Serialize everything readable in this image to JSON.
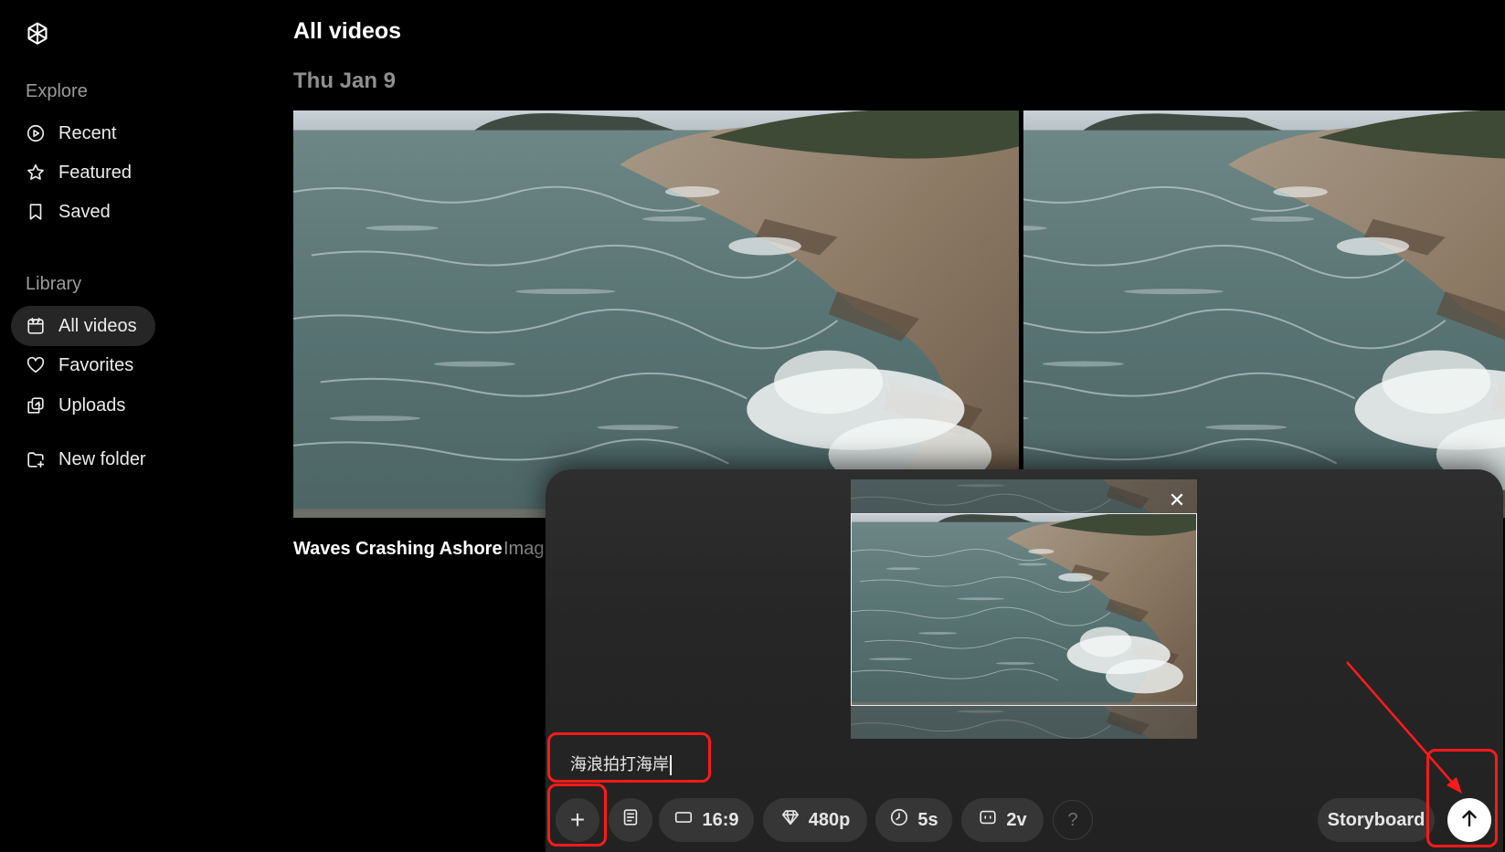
{
  "app": {
    "logo_icon": "openai-logo-icon"
  },
  "sidebar": {
    "explore_label": "Explore",
    "explore_items": [
      {
        "label": "Recent",
        "icon": "play-circle-icon"
      },
      {
        "label": "Featured",
        "icon": "star-icon"
      },
      {
        "label": "Saved",
        "icon": "bookmark-icon"
      }
    ],
    "library_label": "Library",
    "library_items": [
      {
        "label": "All videos",
        "icon": "calendar-icon",
        "active": true
      },
      {
        "label": "Favorites",
        "icon": "heart-icon"
      },
      {
        "label": "Uploads",
        "icon": "uploads-icon"
      }
    ],
    "new_folder_label": "New folder"
  },
  "main": {
    "title": "All videos",
    "date_heading": "Thu Jan 9",
    "video": {
      "title": "Waves Crashing Ashore",
      "subtitle": "Imag"
    }
  },
  "composer": {
    "prompt_text": "海浪拍打海岸",
    "toolbar": {
      "add_label": "+",
      "aspect_ratio": "16:9",
      "resolution": "480p",
      "duration": "5s",
      "variations": "2v",
      "help": "?",
      "storyboard": "Storyboard"
    }
  },
  "colors": {
    "background": "#000000",
    "panel": "#262626",
    "annotation": "#ff1a1a"
  }
}
